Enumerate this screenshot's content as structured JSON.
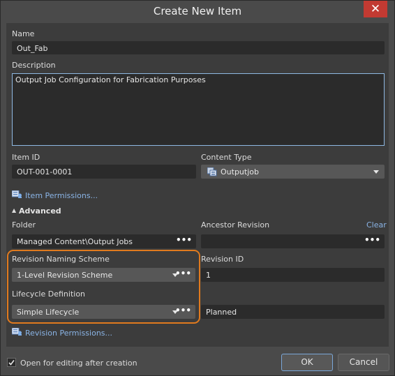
{
  "window": {
    "title": "Create New Item",
    "close_glyph": "✕"
  },
  "name": {
    "label": "Name",
    "value": "Out_Fab"
  },
  "description": {
    "label": "Description",
    "value": "Output Job Configuration for Fabrication Purposes"
  },
  "item_id": {
    "label": "Item ID",
    "value": "OUT-001-0001"
  },
  "content_type": {
    "label": "Content Type",
    "value": "Outputjob",
    "icon": "outputjob-icon"
  },
  "item_permissions": {
    "label": "Item Permissions...",
    "icon": "permissions-icon"
  },
  "advanced": {
    "label": "Advanced",
    "expander": "▲"
  },
  "folder": {
    "label": "Folder",
    "value": "Managed Content\\Output Jobs",
    "browse": "•••"
  },
  "ancestor_revision": {
    "label": "Ancestor Revision",
    "clear_label": "Clear",
    "value": "",
    "browse": "•••"
  },
  "revision_naming": {
    "label": "Revision Naming Scheme",
    "value": "1-Level Revision Scheme",
    "browse": "•••"
  },
  "revision_id": {
    "label": "Revision ID",
    "value": "1"
  },
  "lifecycle": {
    "label": "Lifecycle Definition",
    "value": "Simple Lifecycle",
    "browse": "•••",
    "state_value": "Planned"
  },
  "revision_permissions": {
    "label": "Revision Permissions...",
    "icon": "permissions-icon"
  },
  "footer": {
    "open_for_editing": "Open for editing after creation",
    "open_checked": true,
    "ok": "OK",
    "cancel": "Cancel"
  },
  "colors": {
    "background": "#4a4a4a",
    "panel": "#3c3c3c",
    "field": "#2b2b2b",
    "link": "#8ab4e6",
    "highlight": "#e07a1e",
    "close": "#c23a32"
  }
}
